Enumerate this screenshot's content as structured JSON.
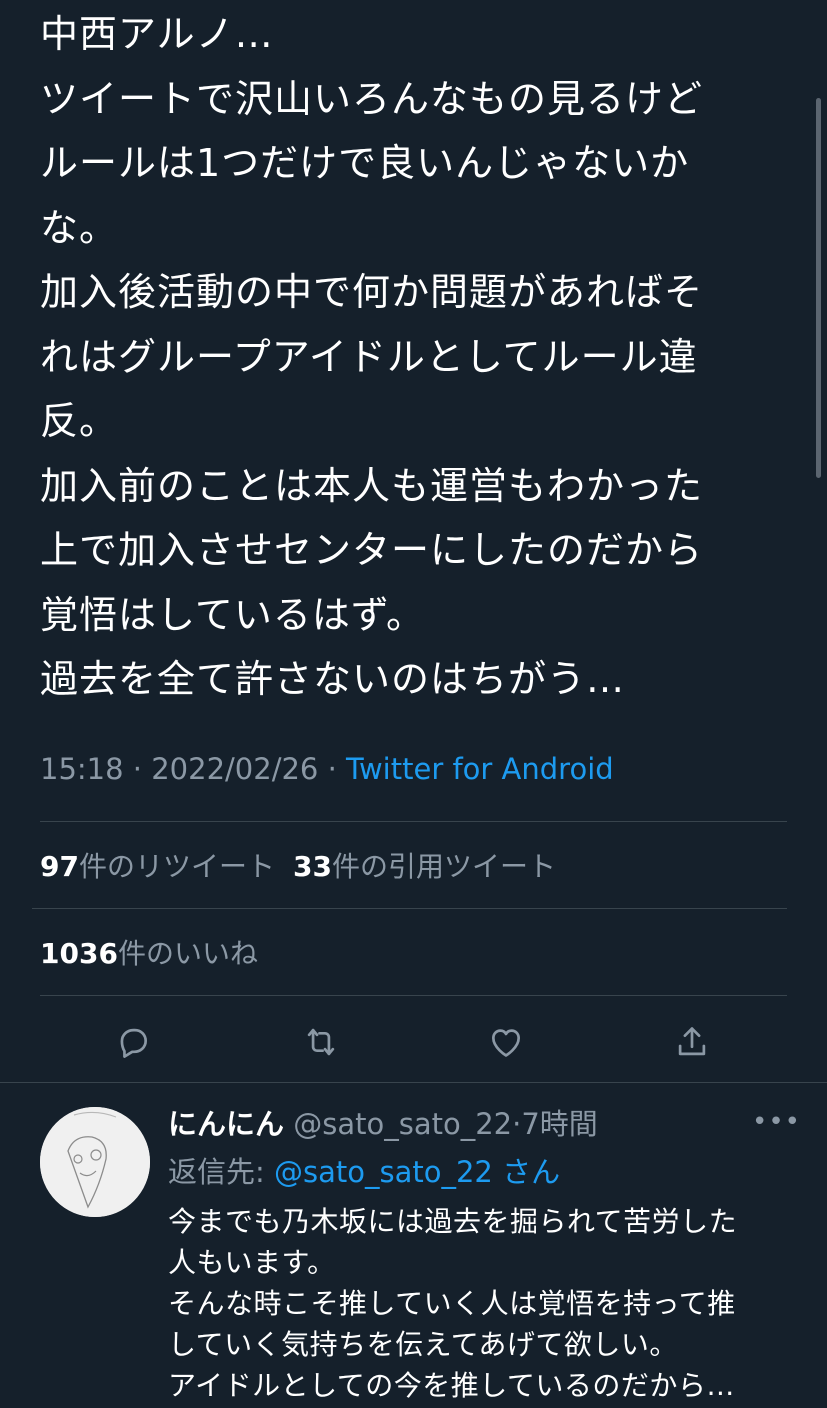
{
  "tweet": {
    "lines": [
      "中西アルノ…",
      "ツイートで沢山いろんなもの見るけど",
      "ルールは1つだけで良いんじゃないか",
      "な。",
      "加入後活動の中で何か問題があればそ",
      "れはグループアイドルとしてルール違",
      "反。",
      "加入前のことは本人も運営もわかった",
      "上で加入させセンターにしたのだから",
      "覚悟はしているはず。",
      "過去を全て許さないのはちがう…"
    ],
    "time": "15:18",
    "date": "2022/02/26",
    "separator": " · ",
    "source": "Twitter for Android"
  },
  "stats": {
    "retweets_count": "97",
    "retweets_label": "件のリツイート",
    "quotes_count": "33",
    "quotes_label": "件の引用ツイート",
    "likes_count": "1036",
    "likes_label": "件のいいね"
  },
  "actions": {
    "icons": [
      "reply-icon",
      "retweet-icon",
      "like-icon",
      "share-icon"
    ]
  },
  "reply": {
    "display_name": "にんにん",
    "handle": "@sato_sato_22",
    "time_separator": "·",
    "time": "7時間",
    "more_label": "•••",
    "replying_to_label": "返信先:",
    "replying_to_handle": "@sato_sato_22",
    "replying_to_suffix": "さん",
    "lines": [
      "今までも乃木坂には過去を掘られて苦労した",
      "人もいます。",
      "そんな時こそ推していく人は覚悟を持って推",
      "していく気持ちを伝えてあげて欲しい。",
      "アイドルとしての今を推しているのだから…"
    ]
  },
  "colors": {
    "background": "#15202b",
    "text": "#ffffff",
    "secondary": "#8b98a5",
    "accent": "#1d9bf0",
    "divider": "#38444d"
  }
}
